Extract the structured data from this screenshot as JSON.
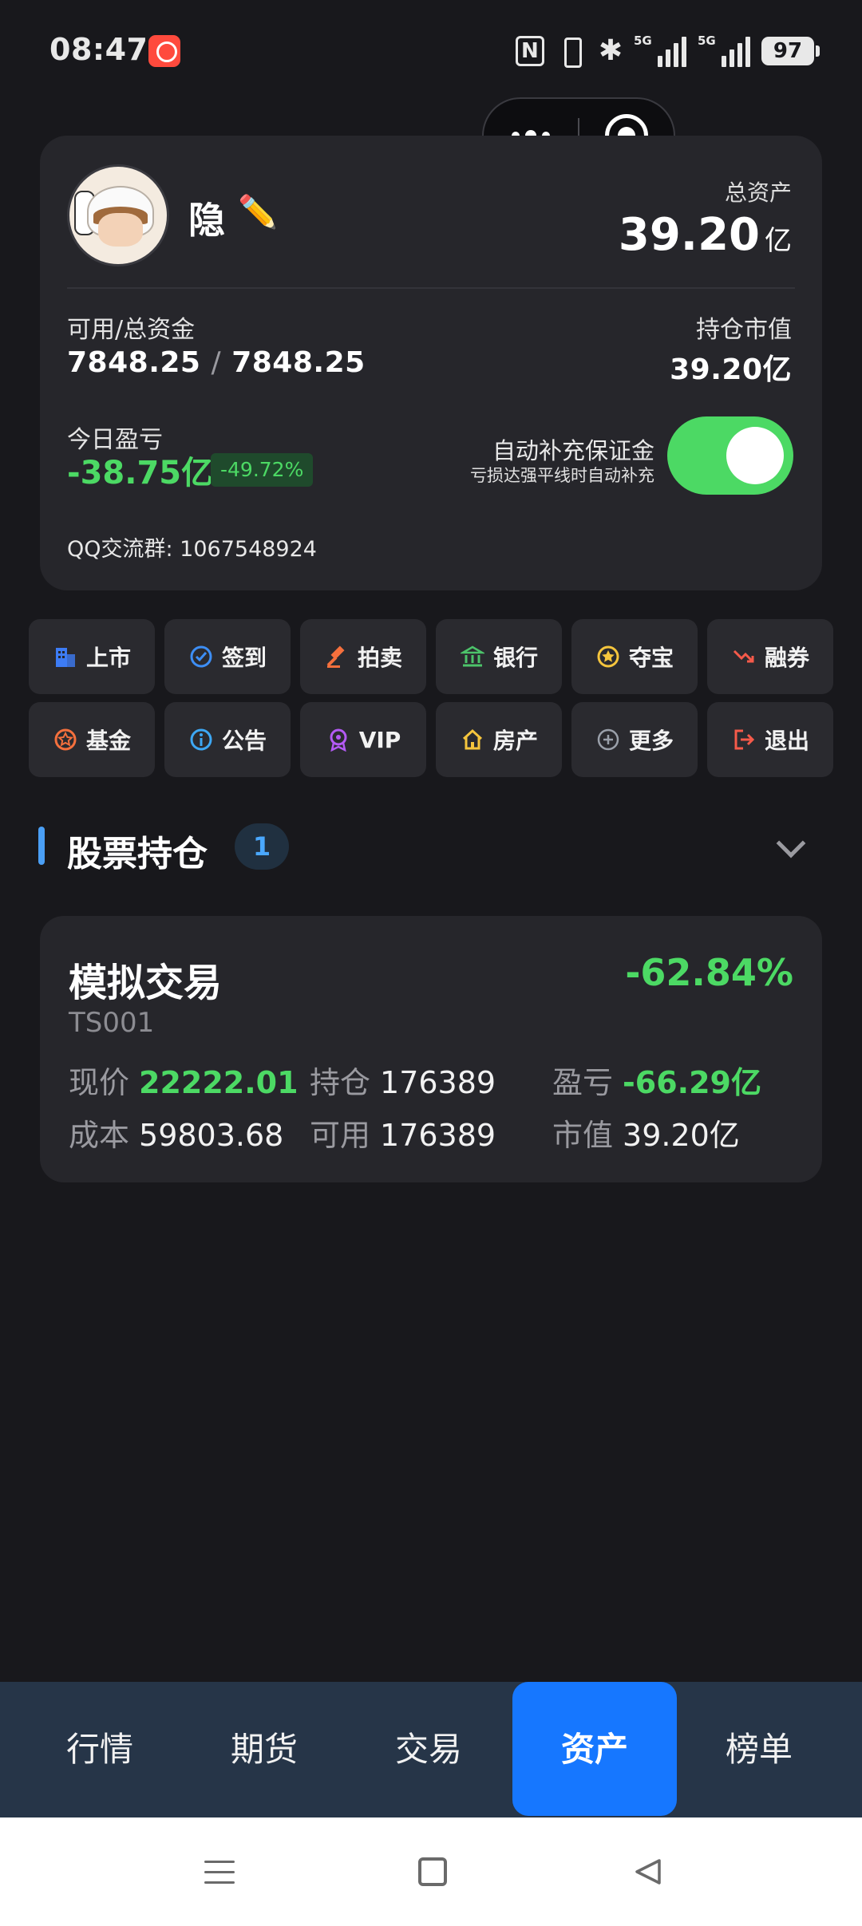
{
  "status_bar": {
    "time": "08:47",
    "net1": "5G",
    "net2": "5G",
    "battery": "97"
  },
  "profile": {
    "username": "隐",
    "edit_icon": "✏️",
    "total_assets_label": "总资产",
    "total_assets_value": "39.20",
    "total_assets_unit": "亿"
  },
  "funds": {
    "available_total_label": "可用/总资金",
    "available": "7848.25",
    "separator": "/",
    "total": "7848.25",
    "market_value_label": "持仓市值",
    "market_value": "39.20亿"
  },
  "today": {
    "pnl_label": "今日盈亏",
    "pnl_value": "-38.75亿",
    "pnl_pct": "-49.72%"
  },
  "auto_margin": {
    "title": "自动补充保证金",
    "subtitle": "亏损达强平线时自动补充",
    "enabled": true
  },
  "qq_group": "QQ交流群: 1067548924",
  "menu": [
    {
      "label": "上市",
      "icon": "building-icon",
      "color": "#3d7cf5"
    },
    {
      "label": "签到",
      "icon": "check-circle-icon",
      "color": "#3d8ef5"
    },
    {
      "label": "拍卖",
      "icon": "gavel-icon",
      "color": "#f5703d"
    },
    {
      "label": "银行",
      "icon": "bank-icon",
      "color": "#4cc36a"
    },
    {
      "label": "夺宝",
      "icon": "star-circle-icon",
      "color": "#f5c53d"
    },
    {
      "label": "融券",
      "icon": "trend-down-icon",
      "color": "#f55a4a"
    },
    {
      "label": "基金",
      "icon": "star-badge-icon",
      "color": "#f5703d"
    },
    {
      "label": "公告",
      "icon": "info-icon",
      "color": "#3da8f5"
    },
    {
      "label": "VIP",
      "icon": "medal-icon",
      "color": "#b45af5"
    },
    {
      "label": "房产",
      "icon": "house-icon",
      "color": "#f5c53d"
    },
    {
      "label": "更多",
      "icon": "plus-circle-icon",
      "color": "#9aa0aa"
    },
    {
      "label": "退出",
      "icon": "logout-icon",
      "color": "#f55a4a"
    }
  ],
  "holdings_section": {
    "title": "股票持仓",
    "count": "1"
  },
  "holding": {
    "name": "模拟交易",
    "code": "TS001",
    "change_pct": "-62.84%",
    "price_label": "现价",
    "price": "22222.01",
    "position_label": "持仓",
    "position": "176389",
    "pnl_label": "盈亏",
    "pnl": "-66.29亿",
    "cost_label": "成本",
    "cost": "59803.68",
    "available_label": "可用",
    "available": "176389",
    "market_value_label": "市值",
    "market_value": "39.20亿"
  },
  "tabs": [
    "行情",
    "期货",
    "交易",
    "资产",
    "榜单"
  ],
  "active_tab": "资产",
  "colors": {
    "background": "#18181c",
    "card": "#26262b",
    "profit_green": "#4cd964",
    "accent_blue": "#1677ff",
    "tabbar": "#263548"
  }
}
